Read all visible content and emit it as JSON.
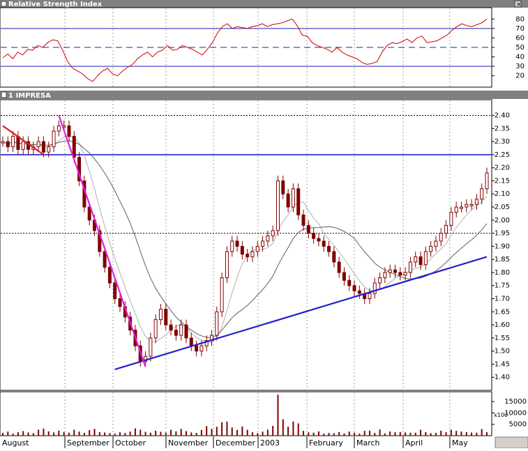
{
  "panels": {
    "rsi_title": "Relative Strength Index",
    "price_title": "1 IMPRESA"
  },
  "volume_unit": "x100",
  "colors": {
    "title_bar": "#808080",
    "title_text": "#ffffff",
    "rsi_line": "#cc0000",
    "rsi_levels": "#1f1fb0",
    "candle": "#800000",
    "support_line": "#1f1fd0",
    "fast_trend": "#e020e0",
    "early_trend": "#dd2020",
    "resistance": "#1f1fd0",
    "ma": "#808080",
    "dotted": "#1f1fb0",
    "volume": "#800000"
  },
  "chart_data": [
    {
      "type": "line",
      "title": "Relative Strength Index",
      "ylim": [
        8,
        92
      ],
      "yticks": [
        20,
        30,
        40,
        50,
        60,
        70,
        80
      ],
      "levels": [
        {
          "value": 30,
          "style": "solid"
        },
        {
          "value": 50,
          "style": "dashed"
        },
        {
          "value": 70,
          "style": "solid"
        }
      ],
      "series": [
        {
          "values": [
            39,
            43,
            38,
            45,
            42,
            48,
            47,
            52,
            50,
            55,
            58,
            57,
            47,
            35,
            28,
            25,
            22,
            17,
            14,
            20,
            25,
            28,
            22,
            20,
            25,
            29,
            32,
            38,
            42,
            45,
            40,
            45,
            47,
            52,
            47,
            48,
            52,
            50,
            48,
            45,
            42,
            48,
            55,
            65,
            72,
            75,
            70,
            72,
            71,
            70,
            72,
            73,
            75,
            72,
            74,
            75,
            76,
            78,
            80,
            73,
            63,
            62,
            55,
            52,
            50,
            48,
            45,
            50,
            45,
            42,
            40,
            38,
            34,
            32,
            33,
            35,
            45,
            52,
            55,
            54,
            56,
            59,
            55,
            60,
            62,
            55,
            56,
            57,
            60,
            63,
            68,
            72,
            75,
            73,
            72,
            74,
            76,
            80
          ]
        }
      ]
    },
    {
      "type": "candlestick",
      "title": "1 IMPRESA",
      "ylim": [
        1.35,
        2.46
      ],
      "yticks": [
        "1.40",
        "1.45",
        "1.50",
        "1.55",
        "1.60",
        "1.65",
        "1.70",
        "1.75",
        "1.80",
        "1.85",
        "1.90",
        "1.95",
        "2.00",
        "2.05",
        "2.10",
        "2.15",
        "2.20",
        "2.25",
        "2.30",
        "2.35",
        "2.40"
      ],
      "x_months": [
        "August",
        "September",
        "October",
        "November",
        "December",
        "2003",
        "February",
        "March",
        "April",
        "May"
      ],
      "closes": [
        2.3,
        2.28,
        2.32,
        2.27,
        2.3,
        2.27,
        2.28,
        2.3,
        2.26,
        2.28,
        2.34,
        2.36,
        2.36,
        2.32,
        2.24,
        2.15,
        2.05,
        2.0,
        1.96,
        1.88,
        1.82,
        1.76,
        1.7,
        1.67,
        1.63,
        1.58,
        1.52,
        1.46,
        1.48,
        1.55,
        1.62,
        1.66,
        1.6,
        1.58,
        1.56,
        1.6,
        1.55,
        1.52,
        1.5,
        1.52,
        1.54,
        1.56,
        1.65,
        1.78,
        1.88,
        1.92,
        1.9,
        1.87,
        1.86,
        1.88,
        1.9,
        1.92,
        1.94,
        1.96,
        2.15,
        2.1,
        2.05,
        2.12,
        2.02,
        1.98,
        1.95,
        1.93,
        1.92,
        1.9,
        1.88,
        1.84,
        1.8,
        1.77,
        1.75,
        1.73,
        1.72,
        1.7,
        1.72,
        1.76,
        1.78,
        1.8,
        1.81,
        1.8,
        1.79,
        1.8,
        1.84,
        1.86,
        1.83,
        1.88,
        1.9,
        1.92,
        1.95,
        1.98,
        2.03,
        2.05,
        2.05,
        2.06,
        2.06,
        2.08,
        2.12,
        2.18
      ],
      "lines": [
        {
          "name": "resistance",
          "value": 2.25
        },
        {
          "name": "upper-dotted",
          "value": 2.4
        },
        {
          "name": "lower-dotted",
          "value": 1.95
        }
      ],
      "trendlines": [
        {
          "name": "support",
          "from": [
            22,
            1.43
          ],
          "to": [
            95,
            1.86
          ]
        },
        {
          "name": "fast-decline",
          "from": [
            11,
            2.4
          ],
          "to": [
            28,
            1.44
          ]
        },
        {
          "name": "early-decline",
          "from": [
            0,
            2.36
          ],
          "to": [
            8,
            2.25
          ]
        }
      ]
    },
    {
      "type": "bar",
      "title": "",
      "yticks": [
        5000,
        10000,
        15000
      ],
      "ylim": [
        0,
        19000
      ],
      "values": [
        1200,
        1800,
        900,
        1500,
        2000,
        1400,
        1100,
        2600,
        3100,
        1900,
        1400,
        2200,
        1600,
        1300,
        2600,
        1800,
        1200,
        2400,
        3000,
        1600,
        1400,
        1100,
        900,
        1500,
        1200,
        1800,
        3200,
        2600,
        1700,
        1300,
        2200,
        1700,
        1400,
        2600,
        1900,
        3000,
        2000,
        1400,
        1200,
        2500,
        4200,
        3000,
        3900,
        5900,
        6200,
        3600,
        2500,
        4000,
        2600,
        1500,
        1100,
        1800,
        2600,
        4300,
        18000,
        7200,
        3900,
        6200,
        5400,
        2100,
        1500,
        1300,
        1900,
        900,
        1200,
        1100,
        1600,
        1000,
        1800,
        1300,
        900,
        2100,
        2200,
        1200,
        2700,
        1000,
        1800,
        1500,
        1600,
        1400,
        1300,
        1300,
        2600,
        1600,
        1100,
        1200,
        2200,
        1500,
        2600,
        2100,
        1800,
        1600,
        1400,
        1300,
        2900,
        1500
      ]
    }
  ]
}
